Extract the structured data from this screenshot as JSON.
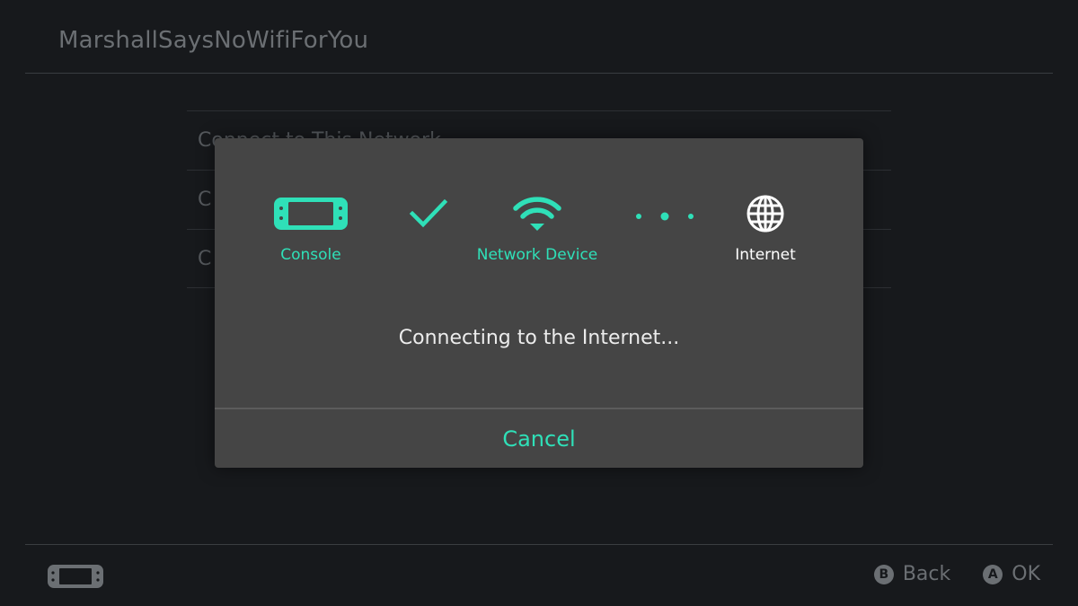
{
  "colors": {
    "accent": "#2fe0b8",
    "dialog_bg": "#454545",
    "screen_bg": "#17191c",
    "text_light": "#ececec",
    "text_dim": "#6b6f73"
  },
  "background": {
    "network_name": "MarshallSaysNoWifiForYou",
    "list_items": [
      {
        "label": "Connect to This Network"
      },
      {
        "label": "C"
      },
      {
        "label": "C"
      }
    ]
  },
  "dialog": {
    "steps": [
      {
        "label": "Console",
        "icon": "console-icon",
        "state": "done"
      },
      {
        "label": "Network Device",
        "icon": "wifi-icon",
        "state": "done"
      },
      {
        "label": "Internet",
        "icon": "globe-icon",
        "state": "pending"
      }
    ],
    "connectors": [
      {
        "icon": "check-icon",
        "state": "done"
      },
      {
        "icon": "dots-icon",
        "state": "in-progress"
      }
    ],
    "message": "Connecting to the Internet...",
    "cancel_label": "Cancel"
  },
  "footer": {
    "buttons": [
      {
        "glyph": "B",
        "label": "Back"
      },
      {
        "glyph": "A",
        "label": "OK"
      }
    ]
  }
}
